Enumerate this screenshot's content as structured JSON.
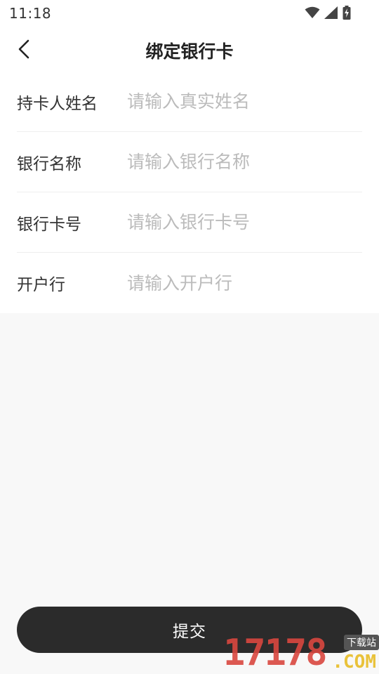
{
  "status_bar": {
    "time": "11:18",
    "icons": [
      "wifi-icon",
      "signal-icon",
      "battery-charging-icon"
    ]
  },
  "nav": {
    "title": "绑定银行卡",
    "back_icon": "chevron-left-icon"
  },
  "form": {
    "fields": [
      {
        "label": "持卡人姓名",
        "value": "",
        "placeholder": "请输入真实姓名"
      },
      {
        "label": "银行名称",
        "value": "",
        "placeholder": "请输入银行名称"
      },
      {
        "label": "银行卡号",
        "value": "",
        "placeholder": "请输入银行卡号"
      },
      {
        "label": "开户行",
        "value": "",
        "placeholder": "请输入开户行"
      }
    ]
  },
  "submit": {
    "label": "提交"
  },
  "watermark": {
    "digits": "17178",
    "suffix": ".COM",
    "tag": "下载站"
  },
  "colors": {
    "background": "#f8f8f8",
    "surface": "#ffffff",
    "primary_button": "#2b2b2b",
    "placeholder": "#bbbbbb",
    "text": "#333333"
  }
}
